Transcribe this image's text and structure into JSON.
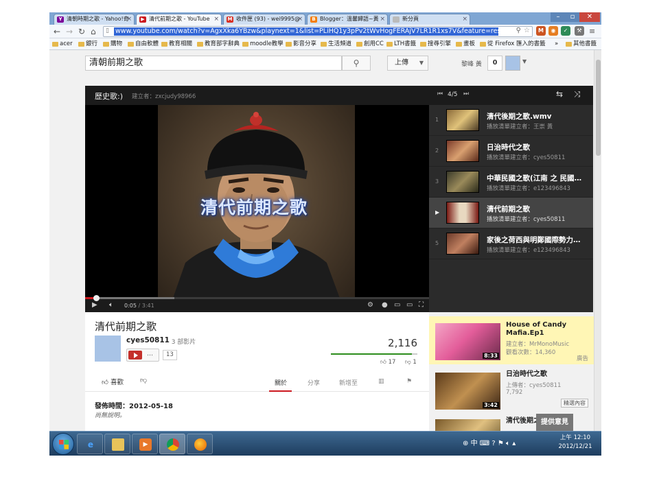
{
  "browser": {
    "tabs": [
      {
        "title": "清朝時期之歌 - Yahoo!奇",
        "favicon": "yahoo-icon",
        "color": "#7b0099"
      },
      {
        "title": "清代前期之歌 - YouTube",
        "favicon": "youtube-icon",
        "color": "#cc181e"
      },
      {
        "title": "收件匣 (93) - wei9995@",
        "favicon": "gmail-icon",
        "color": "#d93025"
      },
      {
        "title": "Blogger：溫馨歸語~黃",
        "favicon": "blogger-icon",
        "color": "#f57d00"
      },
      {
        "title": "新分頁",
        "favicon": "newtab-icon",
        "color": "#999999"
      }
    ],
    "url": "www.youtube.com/watch?v=AgxXka6YBzw&playnext=1&list=PLiHQ1y3pPv2tWvHogFERAjV7LR1R1xs7V&feature=results_main",
    "bookmarks": [
      "acer",
      "銀行",
      "購物",
      "自由軟體",
      "教育相關",
      "教育部字辭典",
      "moodle教學",
      "影音分享",
      "生活頻道",
      "創用CC",
      "LTH書籤",
      "搜尋引擎",
      "畫板",
      "從 Firefox 匯入的書籤",
      "其他書籤"
    ]
  },
  "masthead": {
    "search_value": "清朝前期之歌",
    "upload_label": "上傳",
    "username": "黎峰 黃",
    "notifications": "0"
  },
  "playlist": {
    "title": "歷史歌:)",
    "owner": "建立者：zxcjudy98966",
    "position": "4/5",
    "items": [
      {
        "num": "1",
        "title": "清代後期之歌.wmv",
        "by": "播放清單建立者：王崇 黃"
      },
      {
        "num": "2",
        "title": "日治時代之歌",
        "by": "播放清單建立者：cyes50811"
      },
      {
        "num": "3",
        "title": "中華民國之歌(江南 之 民國…",
        "by": "播放清單建立者：e123496843"
      },
      {
        "num": "▶",
        "title": "清代前期之歌",
        "by": "播放清單建立者：cyes50811"
      },
      {
        "num": "5",
        "title": "家後之荷西與明鄭國際勢力…",
        "by": "播放清單建立者：e123496843"
      }
    ]
  },
  "player": {
    "overlay_title": "清代前期之歌",
    "current_time": "0:05",
    "duration": "/ 3:41",
    "played_fraction": 0.023,
    "buffered_fraction": 0.26
  },
  "video": {
    "title": "清代前期之歌",
    "owner": "cyes50811",
    "owner_videos": "· 3 部影片",
    "subscribers": "13",
    "views": "2,116",
    "likes": "17",
    "dislikes": "1",
    "like_ratio": 0.94,
    "like_label": "喜歡",
    "tabs": [
      "關於",
      "分享",
      "新增至"
    ],
    "published": "發佈時間：2012-05-18",
    "description": "尚無說明。"
  },
  "sidebar": {
    "items": [
      {
        "title": "House of Candy Mafia.Ep1",
        "by": "建立者：MrMonoMusic",
        "views": "觀看次數：14,360",
        "duration": "8:33",
        "badge": "廣告"
      },
      {
        "title": "日治時代之歌",
        "by": "上傳者：cyes50811",
        "views": "7,792",
        "duration": "3:42",
        "badge": "精選內容"
      },
      {
        "title": "清代後期之歌",
        "by": "",
        "views": "",
        "duration": "",
        "badge": ""
      }
    ],
    "feedback": "提供意見"
  },
  "taskbar": {
    "tray": "中",
    "time": "上午 12:10",
    "date": "2012/12/21"
  }
}
